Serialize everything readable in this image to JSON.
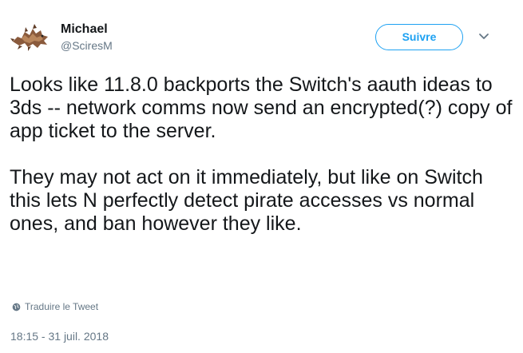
{
  "author": {
    "display_name": "Michael",
    "handle": "@SciresM"
  },
  "follow_label": "Suivre",
  "tweet": {
    "paragraphs": [
      "Looks like 11.8.0 backports the Switch's aauth ideas to 3ds -- network comms now send an encrypted(?) copy of app ticket to the server.",
      "They may not act on it immediately, but like on Switch this lets N perfectly detect pirate accesses vs normal ones, and ban however they like."
    ]
  },
  "translate_label": "Traduire le Tweet",
  "timestamp": "18:15 - 31 juil. 2018",
  "colors": {
    "accent": "#1da1f2",
    "text": "#14171a",
    "secondary": "#657786"
  },
  "icons": {
    "avatar": "avatar",
    "caret": "chevron-down-icon",
    "translate": "globe-icon"
  }
}
